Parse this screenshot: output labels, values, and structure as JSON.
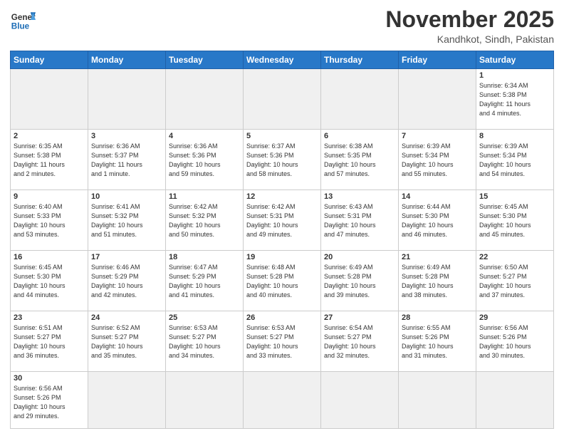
{
  "header": {
    "logo_general": "General",
    "logo_blue": "Blue",
    "month_title": "November 2025",
    "location": "Kandhkot, Sindh, Pakistan"
  },
  "weekdays": [
    "Sunday",
    "Monday",
    "Tuesday",
    "Wednesday",
    "Thursday",
    "Friday",
    "Saturday"
  ],
  "weeks": [
    [
      {
        "day": "",
        "info": ""
      },
      {
        "day": "",
        "info": ""
      },
      {
        "day": "",
        "info": ""
      },
      {
        "day": "",
        "info": ""
      },
      {
        "day": "",
        "info": ""
      },
      {
        "day": "",
        "info": ""
      },
      {
        "day": "1",
        "info": "Sunrise: 6:34 AM\nSunset: 5:38 PM\nDaylight: 11 hours\nand 4 minutes."
      }
    ],
    [
      {
        "day": "2",
        "info": "Sunrise: 6:35 AM\nSunset: 5:38 PM\nDaylight: 11 hours\nand 2 minutes."
      },
      {
        "day": "3",
        "info": "Sunrise: 6:36 AM\nSunset: 5:37 PM\nDaylight: 11 hours\nand 1 minute."
      },
      {
        "day": "4",
        "info": "Sunrise: 6:36 AM\nSunset: 5:36 PM\nDaylight: 10 hours\nand 59 minutes."
      },
      {
        "day": "5",
        "info": "Sunrise: 6:37 AM\nSunset: 5:36 PM\nDaylight: 10 hours\nand 58 minutes."
      },
      {
        "day": "6",
        "info": "Sunrise: 6:38 AM\nSunset: 5:35 PM\nDaylight: 10 hours\nand 57 minutes."
      },
      {
        "day": "7",
        "info": "Sunrise: 6:39 AM\nSunset: 5:34 PM\nDaylight: 10 hours\nand 55 minutes."
      },
      {
        "day": "8",
        "info": "Sunrise: 6:39 AM\nSunset: 5:34 PM\nDaylight: 10 hours\nand 54 minutes."
      }
    ],
    [
      {
        "day": "9",
        "info": "Sunrise: 6:40 AM\nSunset: 5:33 PM\nDaylight: 10 hours\nand 53 minutes."
      },
      {
        "day": "10",
        "info": "Sunrise: 6:41 AM\nSunset: 5:32 PM\nDaylight: 10 hours\nand 51 minutes."
      },
      {
        "day": "11",
        "info": "Sunrise: 6:42 AM\nSunset: 5:32 PM\nDaylight: 10 hours\nand 50 minutes."
      },
      {
        "day": "12",
        "info": "Sunrise: 6:42 AM\nSunset: 5:31 PM\nDaylight: 10 hours\nand 49 minutes."
      },
      {
        "day": "13",
        "info": "Sunrise: 6:43 AM\nSunset: 5:31 PM\nDaylight: 10 hours\nand 47 minutes."
      },
      {
        "day": "14",
        "info": "Sunrise: 6:44 AM\nSunset: 5:30 PM\nDaylight: 10 hours\nand 46 minutes."
      },
      {
        "day": "15",
        "info": "Sunrise: 6:45 AM\nSunset: 5:30 PM\nDaylight: 10 hours\nand 45 minutes."
      }
    ],
    [
      {
        "day": "16",
        "info": "Sunrise: 6:45 AM\nSunset: 5:30 PM\nDaylight: 10 hours\nand 44 minutes."
      },
      {
        "day": "17",
        "info": "Sunrise: 6:46 AM\nSunset: 5:29 PM\nDaylight: 10 hours\nand 42 minutes."
      },
      {
        "day": "18",
        "info": "Sunrise: 6:47 AM\nSunset: 5:29 PM\nDaylight: 10 hours\nand 41 minutes."
      },
      {
        "day": "19",
        "info": "Sunrise: 6:48 AM\nSunset: 5:28 PM\nDaylight: 10 hours\nand 40 minutes."
      },
      {
        "day": "20",
        "info": "Sunrise: 6:49 AM\nSunset: 5:28 PM\nDaylight: 10 hours\nand 39 minutes."
      },
      {
        "day": "21",
        "info": "Sunrise: 6:49 AM\nSunset: 5:28 PM\nDaylight: 10 hours\nand 38 minutes."
      },
      {
        "day": "22",
        "info": "Sunrise: 6:50 AM\nSunset: 5:27 PM\nDaylight: 10 hours\nand 37 minutes."
      }
    ],
    [
      {
        "day": "23",
        "info": "Sunrise: 6:51 AM\nSunset: 5:27 PM\nDaylight: 10 hours\nand 36 minutes."
      },
      {
        "day": "24",
        "info": "Sunrise: 6:52 AM\nSunset: 5:27 PM\nDaylight: 10 hours\nand 35 minutes."
      },
      {
        "day": "25",
        "info": "Sunrise: 6:53 AM\nSunset: 5:27 PM\nDaylight: 10 hours\nand 34 minutes."
      },
      {
        "day": "26",
        "info": "Sunrise: 6:53 AM\nSunset: 5:27 PM\nDaylight: 10 hours\nand 33 minutes."
      },
      {
        "day": "27",
        "info": "Sunrise: 6:54 AM\nSunset: 5:27 PM\nDaylight: 10 hours\nand 32 minutes."
      },
      {
        "day": "28",
        "info": "Sunrise: 6:55 AM\nSunset: 5:26 PM\nDaylight: 10 hours\nand 31 minutes."
      },
      {
        "day": "29",
        "info": "Sunrise: 6:56 AM\nSunset: 5:26 PM\nDaylight: 10 hours\nand 30 minutes."
      }
    ],
    [
      {
        "day": "30",
        "info": "Sunrise: 6:56 AM\nSunset: 5:26 PM\nDaylight: 10 hours\nand 29 minutes."
      },
      {
        "day": "",
        "info": ""
      },
      {
        "day": "",
        "info": ""
      },
      {
        "day": "",
        "info": ""
      },
      {
        "day": "",
        "info": ""
      },
      {
        "day": "",
        "info": ""
      },
      {
        "day": "",
        "info": ""
      }
    ]
  ]
}
